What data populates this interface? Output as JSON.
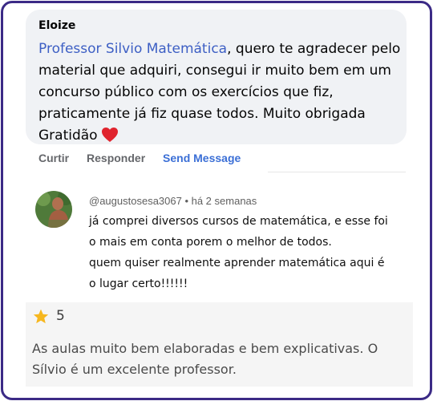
{
  "facebook_comment": {
    "author": "Eloize",
    "mention": "Professor Silvio Matemática",
    "text": ", quero te agradecer pelo material que adquiri, consegui ir muito bem em um concurso público com os exercícios que fiz, praticamente já fiz quase todos. Muito obrigada Gratidão",
    "emoji_icon": "heart-icon",
    "actions": {
      "like": "Curtir",
      "reply": "Responder",
      "send_message": "Send Message"
    }
  },
  "youtube_comment": {
    "handle": "@augustosesa3067 • há 2 semanas",
    "lines": [
      "já comprei diversos cursos de matemática, e esse foi",
      "o mais em conta porem o melhor de todos.",
      "quem quiser realmente aprender matemática aqui  é",
      "o lugar certo!!!!!!"
    ]
  },
  "review": {
    "star_icon": "star-icon",
    "rating": "5",
    "text": "As aulas muito bem elaboradas e bem explicativas. O Sílvio é um excelente professor."
  },
  "colors": {
    "frame_border": "#3b2a86",
    "mention": "#3d5fc4",
    "send_message": "#3b6fd6",
    "heart": "#e0242e",
    "star": "#f6b71f"
  }
}
